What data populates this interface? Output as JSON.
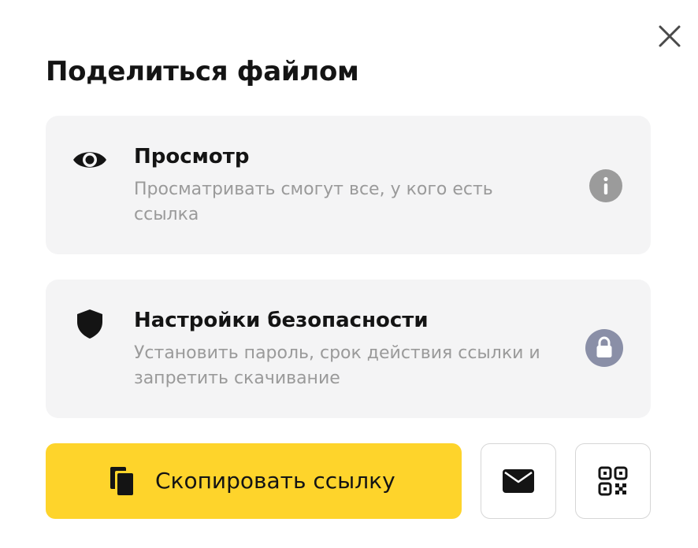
{
  "dialog": {
    "title": "Поделиться файлом",
    "close_icon": "close-icon"
  },
  "view_card": {
    "icon": "eye-icon",
    "title": "Просмотр",
    "description": "Просматривать смогут все, у кого есть ссылка",
    "info_icon": "info-icon"
  },
  "security_card": {
    "icon": "shield-icon",
    "title": "Настройки безопасности",
    "description": "Установить пароль, срок действия ссылки и запретить скачивание",
    "lock_icon": "lock-icon"
  },
  "actions": {
    "copy_label": "Скопировать ссылку",
    "copy_icon": "copy-icon",
    "mail_icon": "mail-icon",
    "qr_icon": "qr-code-icon"
  },
  "colors": {
    "accent": "#fed42b",
    "card_background": "#f4f4f5",
    "text_primary": "#141414",
    "text_secondary": "#9a9a9a",
    "info_badge": "#9b9b9b",
    "lock_badge": "#8a8fa7"
  }
}
